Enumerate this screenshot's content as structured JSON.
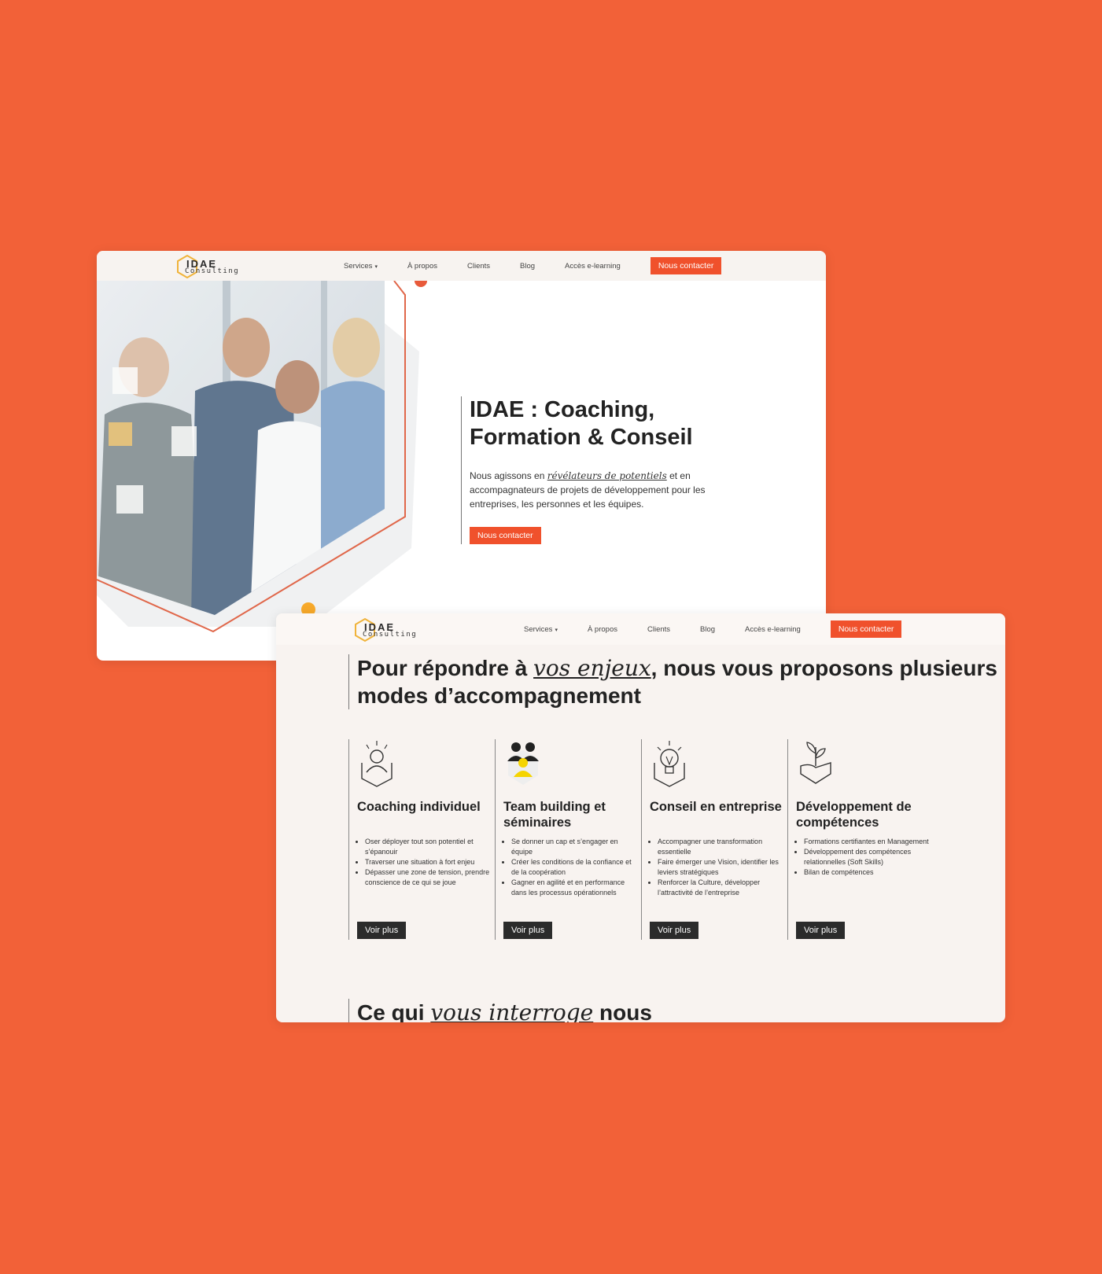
{
  "colors": {
    "background": "#f26138",
    "accent": "#f0512c",
    "dark_button": "#2b2b2b",
    "logo_gold": "#f0b33a"
  },
  "logo": {
    "title": "IDAE",
    "subtitle": "Consulting"
  },
  "nav": {
    "items": [
      "Services",
      "À propos",
      "Clients",
      "Blog",
      "Accès e-learning"
    ],
    "services_caret": "▾",
    "cta": "Nous contacter"
  },
  "hero": {
    "title_line1": "IDAE : Coaching,",
    "title_line2": "Formation & Conseil",
    "desc_before": "Nous agissons en ",
    "desc_script": "révélateurs de potentiels",
    "desc_after": " et en accompagnateurs de projets de développement pour les entreprises, les personnes et les équipes.",
    "cta": "Nous contacter"
  },
  "section": {
    "title_before": "Pour répondre à ",
    "title_script": "vos enjeux",
    "title_after": ", nous vous proposons plusieurs modes d’accompagnement"
  },
  "services": [
    {
      "icon": "person-icon",
      "title": "Coaching individuel",
      "bullets": [
        "Oser déployer tout son potentiel et s’épanouir",
        "Traverser une situation à fort enjeu",
        "Dépasser une zone de tension, prendre conscience de ce qui se joue"
      ],
      "button": "Voir plus"
    },
    {
      "icon": "team-icon",
      "title": "Team building et séminaires",
      "bullets": [
        "Se donner un cap et s’engager en équipe",
        "Créer les conditions de la confiance et de la coopération",
        "Gagner en agilité et en performance dans les processus opérationnels"
      ],
      "button": "Voir plus"
    },
    {
      "icon": "lightbulb-icon",
      "title": "Conseil en entreprise",
      "bullets": [
        "Accompagner une transformation essentielle",
        "Faire émerger une Vision, identifier les leviers stratégiques",
        "Renforcer la Culture, développer l’attractivité de l’entreprise"
      ],
      "button": "Voir plus"
    },
    {
      "icon": "plant-hand-icon",
      "title": "Développement de compétences",
      "bullets": [
        "Formations certifiantes en Management",
        "Développement des compétences relationnelles (Soft Skills)",
        "Bilan de compétences"
      ],
      "button": "Voir plus"
    }
  ],
  "bottom": {
    "title_before": "Ce qui ",
    "title_script": "vous interroge",
    "title_after": " nous"
  }
}
